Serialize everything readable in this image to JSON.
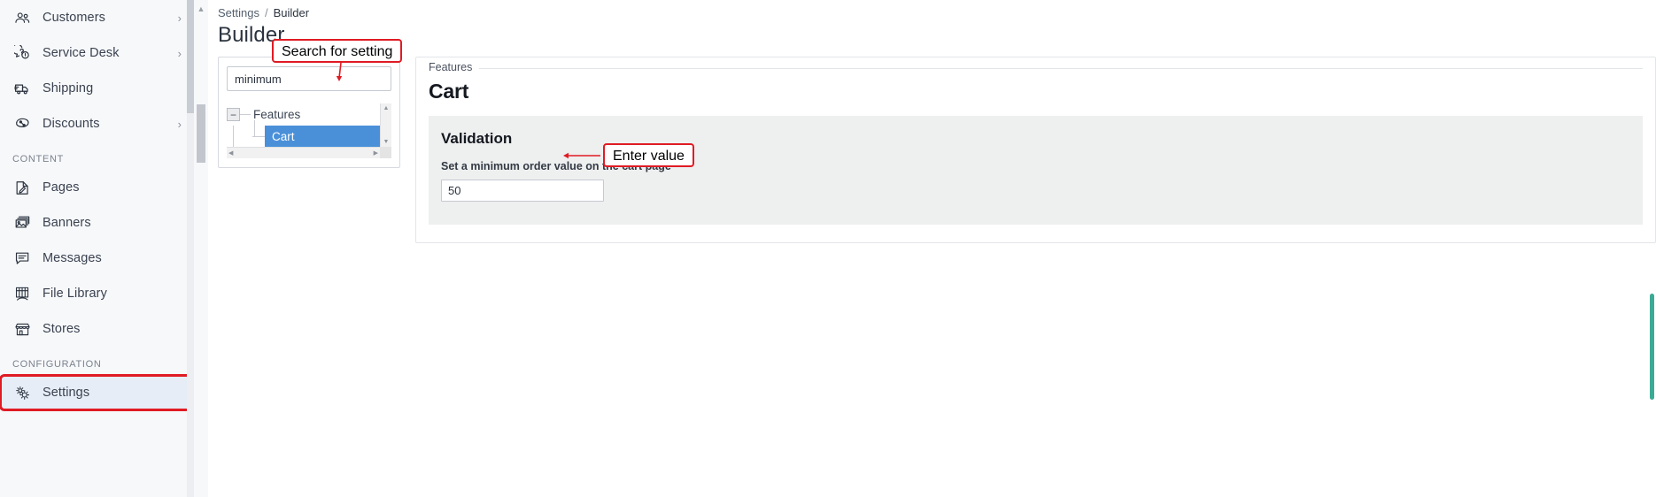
{
  "sidebar": {
    "items": [
      {
        "label": "Customers",
        "icon": "customers-icon",
        "chevron": "›",
        "has_chevron": true,
        "section": null
      },
      {
        "label": "Service Desk",
        "icon": "service-desk-icon",
        "chevron": "›",
        "has_chevron": true,
        "section": null
      },
      {
        "label": "Shipping",
        "icon": "shipping-icon",
        "chevron": "",
        "has_chevron": false,
        "section": null
      },
      {
        "label": "Discounts",
        "icon": "discounts-icon",
        "chevron": "›",
        "has_chevron": true,
        "section": null
      }
    ],
    "section_content": "CONTENT",
    "content_items": [
      {
        "label": "Pages",
        "icon": "pages-icon"
      },
      {
        "label": "Banners",
        "icon": "banners-icon"
      },
      {
        "label": "Messages",
        "icon": "messages-icon"
      },
      {
        "label": "File Library",
        "icon": "file-library-icon"
      },
      {
        "label": "Stores",
        "icon": "stores-icon"
      }
    ],
    "section_configuration": "CONFIGURATION",
    "configuration_items": [
      {
        "label": "Settings",
        "icon": "settings-gear-icon"
      }
    ]
  },
  "breadcrumb": {
    "root": "Settings",
    "separator": "/",
    "current": "Builder"
  },
  "page": {
    "title": "Builder"
  },
  "tree_panel": {
    "search_value": "minimum",
    "search_placeholder": "",
    "toggle_symbol": "−",
    "root_label": "Features",
    "selected_label": "Cart",
    "scroll_up": "▲",
    "scroll_down": "▼",
    "scroll_left": "◀",
    "scroll_right": "▶"
  },
  "settings": {
    "fieldset_legend": "Features",
    "heading": "Cart",
    "validation_title": "Validation",
    "validation_description": "Set a minimum order value on the cart page",
    "value": "50",
    "value_placeholder": ""
  },
  "annotations": {
    "search_callout": "Search for setting",
    "enter_value_callout": "Enter value"
  },
  "colors": {
    "annotation_red": "#e01b24",
    "tree_selected_blue": "#4a90d9",
    "sidebar_active_blue": "#e7edf6",
    "scroll_teal": "#3bab95"
  }
}
